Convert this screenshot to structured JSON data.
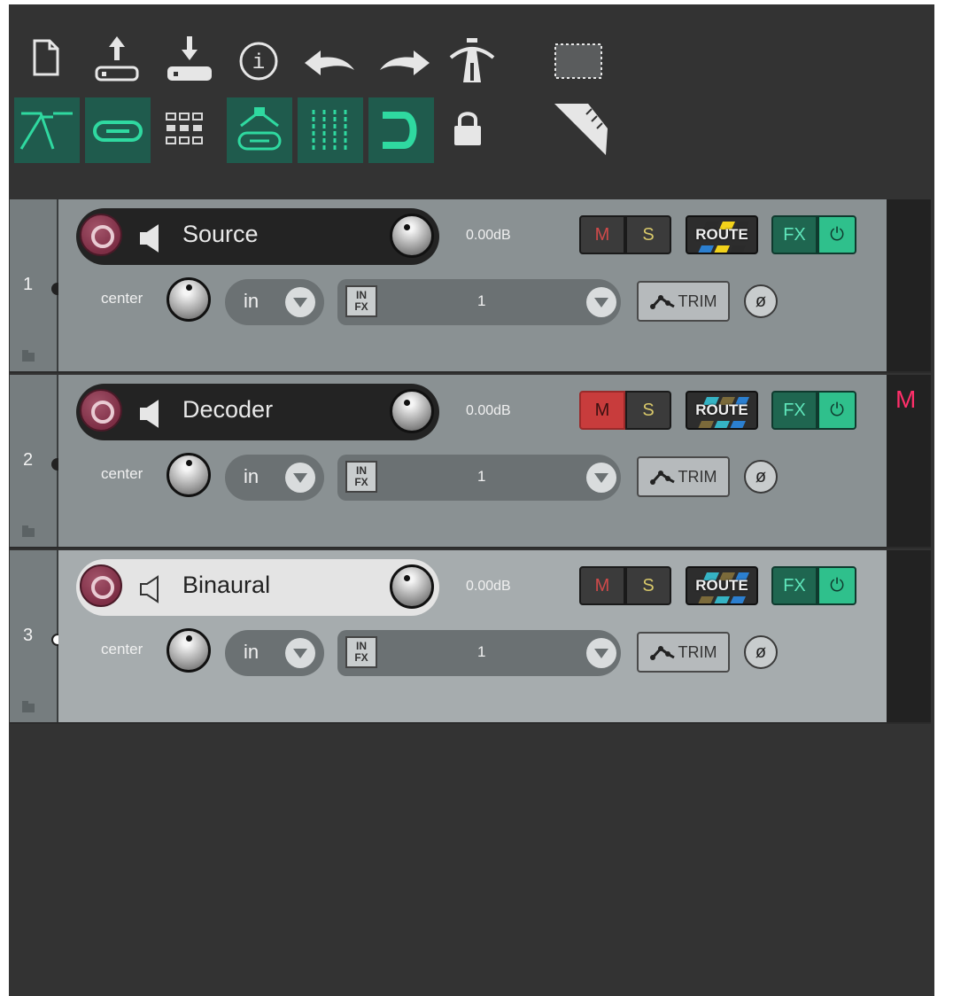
{
  "toolbar": {
    "row1": [
      {
        "name": "new-project-icon",
        "active": false
      },
      {
        "name": "open-project-icon",
        "active": false
      },
      {
        "name": "save-project-icon",
        "active": false
      },
      {
        "name": "project-info-icon",
        "active": false
      },
      {
        "name": "undo-icon",
        "active": false
      },
      {
        "name": "redo-icon",
        "active": false
      },
      {
        "name": "metronome-icon",
        "active": false
      },
      {
        "name": "grid-box-icon",
        "active": false
      }
    ],
    "row2": [
      {
        "name": "auto-crossfade-icon",
        "active": true
      },
      {
        "name": "link-icon",
        "active": true
      },
      {
        "name": "grid-icon",
        "active": false
      },
      {
        "name": "envelope-link-icon",
        "active": true
      },
      {
        "name": "snap-icon",
        "active": true
      },
      {
        "name": "ripple-edit-icon",
        "active": true
      },
      {
        "name": "lock-icon",
        "active": false
      },
      {
        "name": "ruler-icon",
        "active": false
      }
    ]
  },
  "tracks": [
    {
      "number": "1",
      "name": "Source",
      "volume": "0.00dB",
      "pan_label": "center",
      "input_label": "in",
      "fx_label": "IN FX",
      "channel": "1",
      "mute": "M",
      "solo": "S",
      "route": "ROUTE",
      "fx": "FX",
      "power": "⏻",
      "trim": "TRIM",
      "phase": "ø",
      "muted": false,
      "selected": false,
      "mute_indicator": "",
      "speaker_outline": false
    },
    {
      "number": "2",
      "name": "Decoder",
      "volume": "0.00dB",
      "pan_label": "center",
      "input_label": "in",
      "fx_label": "IN FX",
      "channel": "1",
      "mute": "M",
      "solo": "S",
      "route": "ROUTE",
      "fx": "FX",
      "power": "⏻",
      "trim": "TRIM",
      "phase": "ø",
      "muted": true,
      "selected": false,
      "mute_indicator": "M",
      "speaker_outline": false
    },
    {
      "number": "3",
      "name": "Binaural",
      "volume": "0.00dB",
      "pan_label": "center",
      "input_label": "in",
      "fx_label": "IN FX",
      "channel": "1",
      "mute": "M",
      "solo": "S",
      "route": "ROUTE",
      "fx": "FX",
      "power": "⏻",
      "trim": "TRIM",
      "phase": "ø",
      "muted": false,
      "selected": true,
      "mute_indicator": "",
      "speaker_outline": true
    }
  ],
  "colors": {
    "background": "#333333",
    "toolbar_active": "#1f5b4d",
    "accent_green": "#2fd9a0",
    "mute_active": "#c83c3c",
    "mute_indicator": "#ff2f6a",
    "track_body": "#8a9193",
    "track_selected": "#a6acae"
  }
}
